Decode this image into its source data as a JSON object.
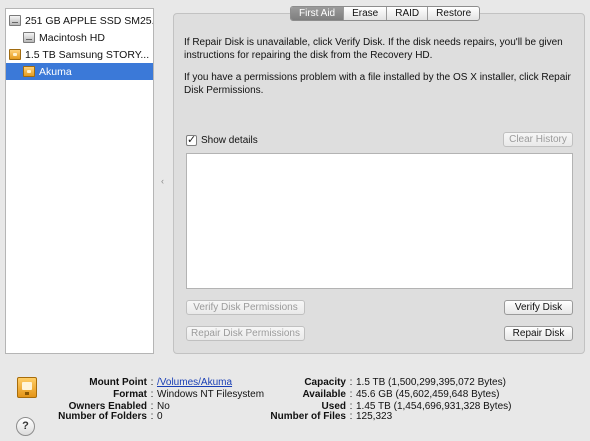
{
  "sidebar": {
    "items": [
      {
        "label": "251 GB APPLE SSD SM25...",
        "icon": "internal-disk-icon"
      },
      {
        "label": "Macintosh HD",
        "icon": "internal-volume-icon"
      },
      {
        "label": "1.5 TB Samsung STORY...",
        "icon": "external-disk-icon"
      },
      {
        "label": "Akuma",
        "icon": "external-volume-icon",
        "selected": true
      }
    ]
  },
  "tabs": [
    {
      "label": "First Aid",
      "active": true
    },
    {
      "label": "Erase"
    },
    {
      "label": "RAID"
    },
    {
      "label": "Restore"
    }
  ],
  "first_aid": {
    "description_1": "If Repair Disk is unavailable, click Verify Disk. If the disk needs repairs, you'll be given instructions for repairing the disk from the Recovery HD.",
    "description_2": "If you have a permissions problem with a file installed by the OS X installer, click Repair Disk Permissions.",
    "show_details_label": "Show details",
    "show_details_checked": true,
    "clear_history_label": "Clear History",
    "verify_permissions_label": "Verify Disk Permissions",
    "repair_permissions_label": "Repair Disk Permissions",
    "verify_disk_label": "Verify Disk",
    "repair_disk_label": "Repair Disk"
  },
  "info": {
    "mount_point_label": "Mount Point",
    "mount_point_value": "/Volumes/Akuma",
    "format_label": "Format",
    "format_value": "Windows NT Filesystem",
    "owners_label": "Owners Enabled",
    "owners_value": "No",
    "folders_label": "Number of Folders",
    "folders_value": "0",
    "capacity_label": "Capacity",
    "capacity_value": "1.5 TB (1,500,299,395,072 Bytes)",
    "available_label": "Available",
    "available_value": "45.6 GB (45,602,459,648 Bytes)",
    "used_label": "Used",
    "used_value": "1.45 TB (1,454,696,931,328 Bytes)",
    "files_label": "Number of Files",
    "files_value": "125,323",
    "separator": ":"
  },
  "help": {
    "label": "?"
  }
}
